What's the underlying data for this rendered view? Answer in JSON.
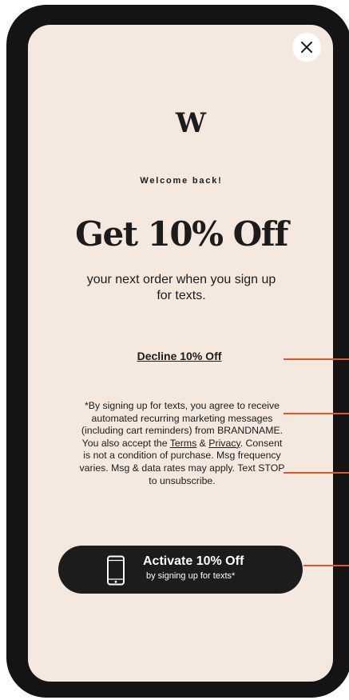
{
  "logo": {
    "mark": "W"
  },
  "popup": {
    "eyebrow": "Welcome back!",
    "headline": "Get 10% Off",
    "subhead": "your next order when you sign up for texts.",
    "decline_label": "Decline 10% Off",
    "disclaimer": {
      "before_terms": "*By signing up for texts, you agree to receive automated recurring marketing messages (including cart reminders) from BRANDNAME. You also accept the ",
      "terms_label": "Terms",
      "ampersand": " & ",
      "privacy_label": "Privacy",
      "after_privacy": ". Consent is not a condition of purchase. Msg frequency varies. Msg & data rates may apply. Text STOP to unsubscribe."
    },
    "cta": {
      "title": "Activate 10% Off",
      "subtitle": "by signing up for texts*"
    }
  },
  "colors": {
    "background": "#f4e8df",
    "device_frame": "#141414",
    "text": "#1c1c1c",
    "annotation": "#e0562c"
  },
  "icons": {
    "close": "close-icon",
    "phone": "mobile-phone-icon"
  }
}
